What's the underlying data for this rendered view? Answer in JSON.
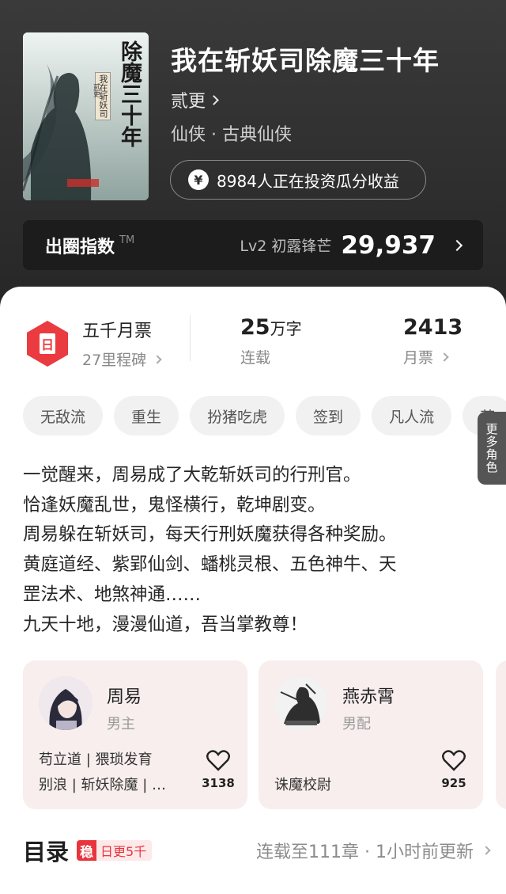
{
  "book": {
    "title": "我在斩妖司除魔三十年",
    "author": "贰更",
    "genre": "仙侠 · 古典仙侠",
    "invest_text": "8984人正在投资瓜分收益",
    "invest_icon": "yen-coin-icon",
    "cover_text": {
      "title_line": "除魔三十年",
      "sub_line": "我在斩妖司",
      "author": "贰更"
    }
  },
  "index_bar": {
    "label": "出圈指数",
    "trademark": "TM",
    "level": "Lv2 初露锋芒",
    "value": "29,937"
  },
  "stats": {
    "badge_glyph": "日",
    "milestone_title": "五千月票",
    "milestone_sub": "27里程碑",
    "words_num": "25",
    "words_unit": "万字",
    "status": "连载",
    "votes": "2413",
    "votes_label": "月票"
  },
  "tags": [
    "无敌流",
    "重生",
    "扮猪吃虎",
    "签到",
    "凡人流",
    "萌"
  ],
  "description": [
    "一觉醒来，周易成了大乾斩妖司的行刑官。",
    "恰逢妖魔乱世，鬼怪横行，乾坤剧变。",
    "周易躲在斩妖司，每天行刑妖魔获得各种奖励。",
    "黄庭道经、紫郢仙剑、蟠桃灵根、五色神牛、天",
    "罡法术、地煞神通……",
    "九天十地，漫漫仙道，吾当掌教尊！"
  ],
  "roles": [
    {
      "name": "周易",
      "type": "男主",
      "desc_line1": "苟立道 | 猥琐发育",
      "desc_line2": "别浪 | 斩妖除魔 | …",
      "likes": "3138"
    },
    {
      "name": "燕赤霄",
      "type": "男配",
      "desc_line1": "诛魔校尉",
      "desc_line2": "",
      "likes": "925"
    }
  ],
  "more_roles": "更多角色",
  "toc": {
    "title": "目录",
    "badge_mark": "稳",
    "badge_text": "日更5千",
    "status": "连载至111章 · 1小时前更新"
  },
  "colors": {
    "accent_red": "#e8343c",
    "hero_bg": "#2e2e2e",
    "role_card_bg": "#f8eeee"
  }
}
